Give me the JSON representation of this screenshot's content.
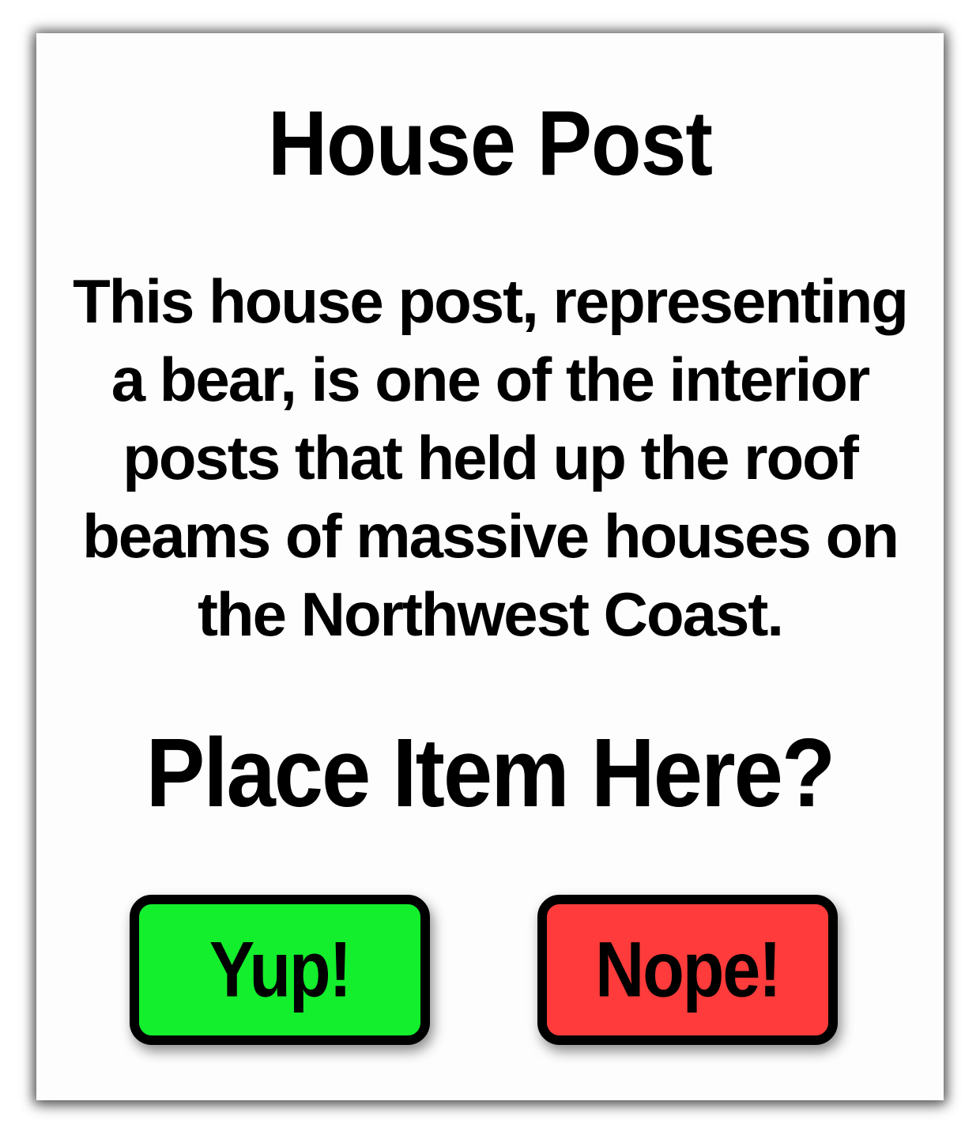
{
  "dialog": {
    "title": "House Post",
    "description": "This house post, representing a bear, is one of the interior posts that held up the roof beams of massive houses on the Northwest Coast.",
    "prompt": "Place Item Here?",
    "buttons": {
      "yes_label": "Yup!",
      "no_label": "Nope!"
    }
  },
  "colors": {
    "yes_button": "#13ef2c",
    "no_button": "#ff3b3b",
    "border": "#000000",
    "panel": "#fdfdfd"
  }
}
